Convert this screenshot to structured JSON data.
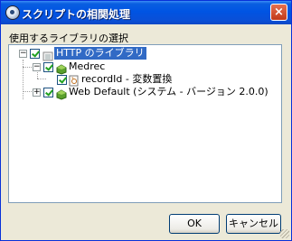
{
  "window": {
    "title": "スクリプトの相関処理",
    "close_glyph": "×"
  },
  "section_label": "使用するライブラリの選択",
  "tree": {
    "root_expander": "−",
    "medrec_expander": "−",
    "webdefault_expander": "+",
    "items": [
      {
        "label": "HTTP のライブラリ",
        "checked": true,
        "selected": true,
        "icon": "library-icon"
      },
      {
        "label": "Medrec",
        "checked": true,
        "icon": "green-package-icon"
      },
      {
        "label": "recordId - 変数置換",
        "checked": true,
        "icon": "rule-document-icon"
      },
      {
        "label": "Web Default (システム - バージョン 2.0.0)",
        "checked": true,
        "icon": "green-package-icon"
      }
    ]
  },
  "buttons": {
    "ok": "OK",
    "cancel": "キャンセル"
  }
}
